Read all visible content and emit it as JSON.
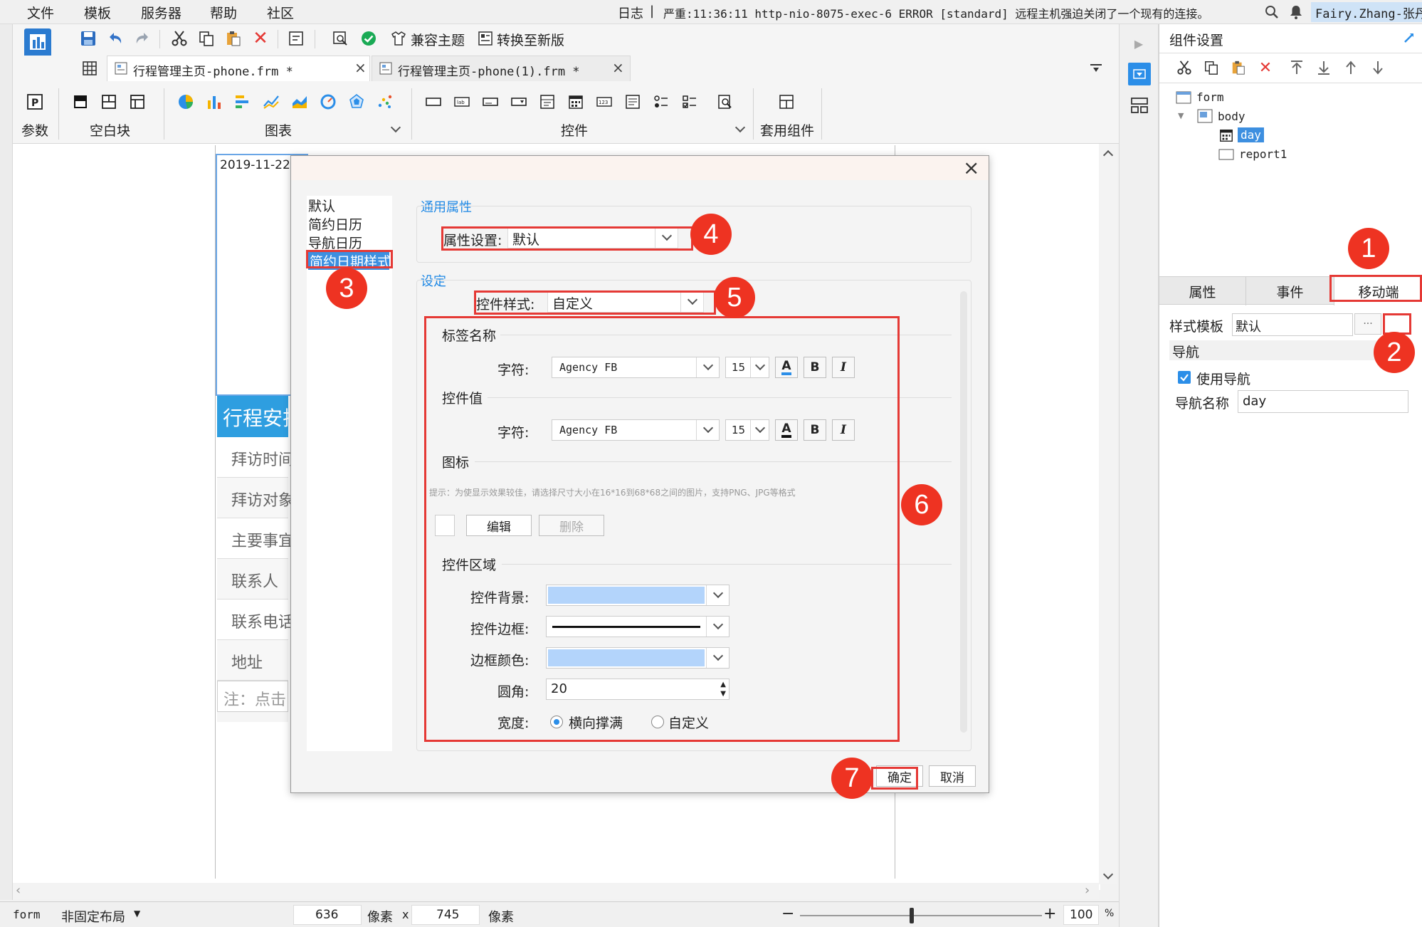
{
  "menu": [
    "文件",
    "模板",
    "服务器",
    "帮助",
    "社区"
  ],
  "log": {
    "prefix": "日志",
    "sep": "|",
    "text": "严重:11:36:11 http-nio-8075-exec-6 ERROR [standard] 远程主机强迫关闭了一个现有的连接。"
  },
  "user": "Fairy.Zhang-张丹",
  "toolbar": {
    "compat_theme": "兼容主题",
    "convert_new": "转换至新版"
  },
  "tabs": [
    {
      "label": "行程管理主页-phone.frm *",
      "close": "×"
    },
    {
      "label": "行程管理主页-phone(1).frm *",
      "close": "×"
    }
  ],
  "ribbon": {
    "param": "参数",
    "blank": "空白块",
    "chart": "图表",
    "control": "控件",
    "widget": "套用组件"
  },
  "canvas": {
    "date_value": "2019-11-22",
    "header": "行程安排",
    "rows": [
      "拜访时间",
      "拜访对象",
      "主要事宜",
      "联系人",
      "联系电话",
      "地址"
    ],
    "note": "注：点击"
  },
  "dialog": {
    "close": "×",
    "list": [
      "默认",
      "简约日历",
      "导航日历",
      "简约日期样式"
    ],
    "selected_index": 3,
    "general_section": "通用属性",
    "attr_label": "属性设置:",
    "attr_value": "默认",
    "settings_section": "设定",
    "style_label": "控件样式:",
    "style_value": "自定义",
    "label_name": "标签名称",
    "font_label": "字符:",
    "font_name": "Agency FB",
    "font_size": "15",
    "bold": "B",
    "italic": "I",
    "font_a": "A",
    "value_section": "控件值",
    "icon_section": "图标",
    "icon_hint": "提示：为使显示效果较佳，请选择尺寸大小在16*16到68*68之间的图片，支持PNG、JPG等格式",
    "edit_btn": "编辑",
    "delete_btn": "删除",
    "area_section": "控件区域",
    "bg_label": "控件背景:",
    "border_label": "控件边框:",
    "border_color_label": "边框颜色:",
    "radius_label": "圆角:",
    "radius_value": "20",
    "width_label": "宽度:",
    "width_opt1": "横向撑满",
    "width_opt2": "自定义",
    "ok": "确定",
    "cancel": "取消",
    "swatch_color": "#b3d4fb"
  },
  "right_panel": {
    "title": "组件设置",
    "tree": [
      "form",
      "body",
      "day",
      "report1"
    ],
    "tabs": [
      "属性",
      "事件",
      "移动端"
    ],
    "template_label": "样式模板",
    "template_value": "默认",
    "more": "···",
    "nav_section": "导航",
    "use_nav": "使用导航",
    "nav_name_label": "导航名称",
    "nav_name_value": "day"
  },
  "statusbar": {
    "form": "form",
    "layout": "非固定布局",
    "width": "636",
    "unit1": "像素",
    "x": "x",
    "height": "745",
    "unit2": "像素",
    "zoom": "100",
    "pct": "%",
    "minus": "−",
    "plus": "+"
  },
  "badges": [
    "1",
    "2",
    "3",
    "4",
    "5",
    "6",
    "7"
  ],
  "colors": {
    "accent": "#1e88e5",
    "red": "#e53935",
    "badge": "#e63322",
    "selected": "#3d8fe0"
  }
}
